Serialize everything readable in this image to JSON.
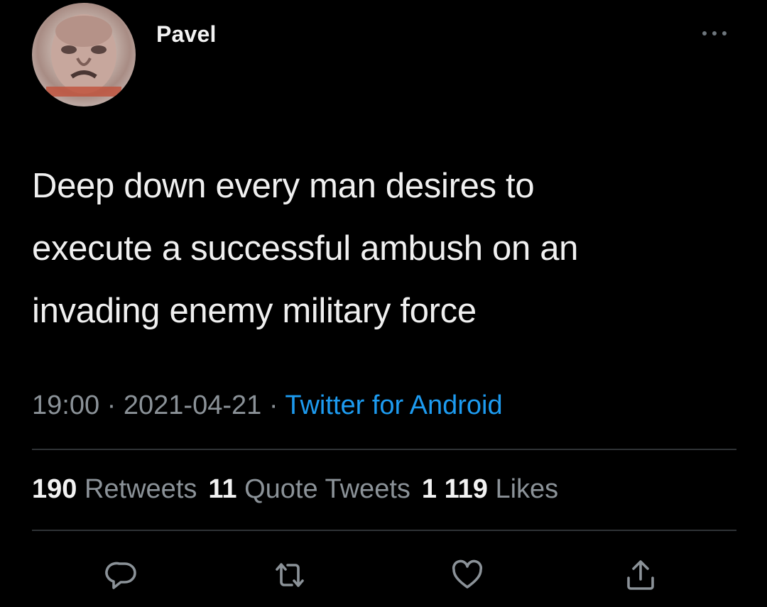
{
  "user": {
    "name": "Pavel",
    "avatar_icon": "profile-photo"
  },
  "tweet": {
    "text_lines": [
      "Deep down every man desires to",
      "execute a successful ambush on an",
      "invading enemy military force"
    ]
  },
  "meta": {
    "time": "19:00",
    "separator": " · ",
    "date": "2021-04-21",
    "source": "Twitter for Android"
  },
  "stats": {
    "retweets_count": "190",
    "retweets_label": "Retweets",
    "quotes_count": "11",
    "quotes_label": "Quote Tweets",
    "likes_count": "1 119",
    "likes_label": "Likes"
  },
  "actions": {
    "icons": [
      "reply-icon",
      "retweet-icon",
      "like-icon",
      "share-icon"
    ]
  },
  "colors": {
    "background": "#000000",
    "text": "#f0f0f0",
    "muted": "#8b9298",
    "accent": "#1d9bf0",
    "divider": "#2f3336"
  }
}
